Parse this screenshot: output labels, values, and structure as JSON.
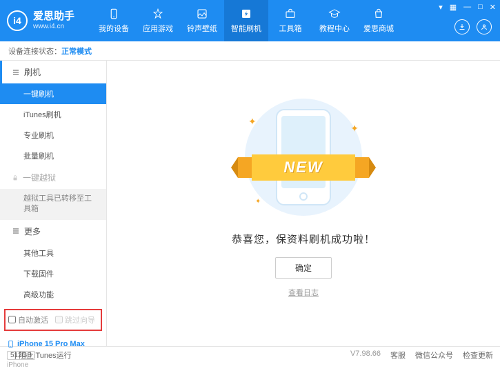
{
  "header": {
    "appName": "爱思助手",
    "appUrl": "www.i4.cn",
    "tabs": [
      {
        "label": "我的设备"
      },
      {
        "label": "应用游戏"
      },
      {
        "label": "铃声壁纸"
      },
      {
        "label": "智能刷机"
      },
      {
        "label": "工具箱"
      },
      {
        "label": "教程中心"
      },
      {
        "label": "爱思商城"
      }
    ],
    "activeTab": 3
  },
  "statusBar": {
    "label": "设备连接状态：",
    "mode": "正常模式"
  },
  "sidebar": {
    "flashTitle": "刷机",
    "flashItems": [
      {
        "label": "一键刷机",
        "active": true
      },
      {
        "label": "iTunes刷机"
      },
      {
        "label": "专业刷机"
      },
      {
        "label": "批量刷机"
      }
    ],
    "jailbreakTitle": "一键越狱",
    "jailbreakNote": "越狱工具已转移至工具箱",
    "moreTitle": "更多",
    "moreItems": [
      {
        "label": "其他工具"
      },
      {
        "label": "下载固件"
      },
      {
        "label": "高级功能"
      }
    ],
    "checkboxes": {
      "autoActivate": "自动激活",
      "skipGuide": "跳过向导"
    },
    "device": {
      "name": "iPhone 15 Pro Max",
      "storage": "512GB",
      "type": "iPhone"
    }
  },
  "content": {
    "ribbonText": "NEW",
    "successMsg": "恭喜您，保资料刷机成功啦！",
    "confirmBtn": "确定",
    "logLink": "查看日志"
  },
  "footer": {
    "blockItunes": "阻止iTunes运行",
    "version": "V7.98.66",
    "links": [
      "客服",
      "微信公众号",
      "检查更新"
    ]
  }
}
